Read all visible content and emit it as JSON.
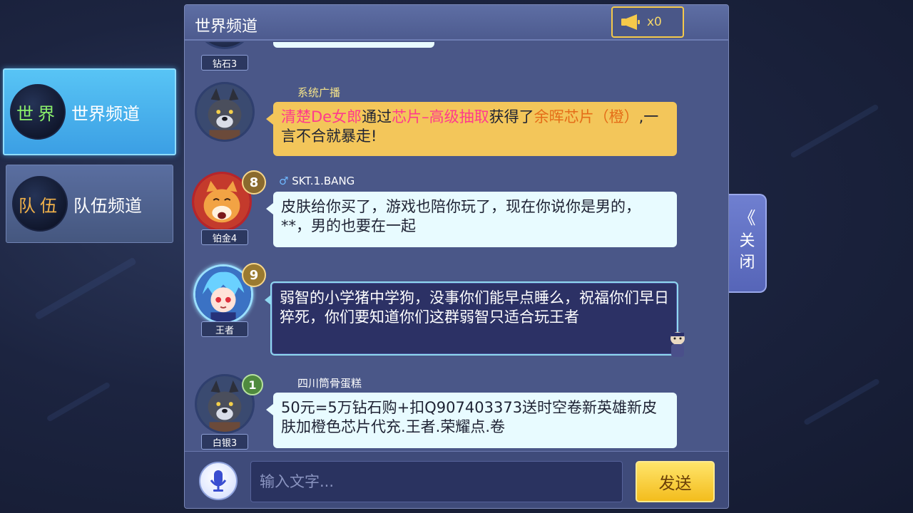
{
  "sidebar": {
    "tabs": [
      {
        "badge": "世界",
        "label": "世界频道"
      },
      {
        "badge": "队伍",
        "label": "队伍频道"
      }
    ]
  },
  "panel": {
    "title": "世界频道",
    "horn_count": "x0"
  },
  "messages": [
    {
      "rank": "钻石3"
    },
    {
      "sender": "系统广播",
      "type": "system",
      "parts": {
        "player": "清楚De女郎",
        "t1": "通过",
        "source": "芯片–高级抽取",
        "t2": "获得了",
        "item": "余晖芯片（橙）",
        "t3": ",一言不合就暴走!"
      }
    },
    {
      "sender": "SKT.1.BANG",
      "gender_icon": "male-icon",
      "level": "8",
      "rank": "铂金4",
      "text": "皮肤给你买了，游戏也陪你玩了，现在你说你是男的，**，男的也要在一起"
    },
    {
      "level": "9",
      "rank": "王者",
      "text": "弱智的小学猪中学狗，没事你们能早点睡么，祝福你们早日猝死，你们要知道你们这群弱智只适合玩王者"
    },
    {
      "sender": "四川筒骨蛋糕",
      "level": "1",
      "rank": "白银3",
      "text": "50元=5万钻石购+扣Q907403373送时空卷新英雄新皮肤加橙色芯片代充.王者.荣耀点.卷"
    }
  ],
  "footer": {
    "input_placeholder": "输入文字...",
    "send_label": "发送"
  },
  "close_tab": {
    "chevron": "《",
    "label": "关闭"
  },
  "colors": {
    "system_bubble": "#f3c65a",
    "normal_bubble": "#e8fbff",
    "vip_bubble": "#2c3165",
    "highlight_pink": "#ff3a8c",
    "highlight_orange": "#e46d18",
    "send_button": "#f3bd1d"
  }
}
